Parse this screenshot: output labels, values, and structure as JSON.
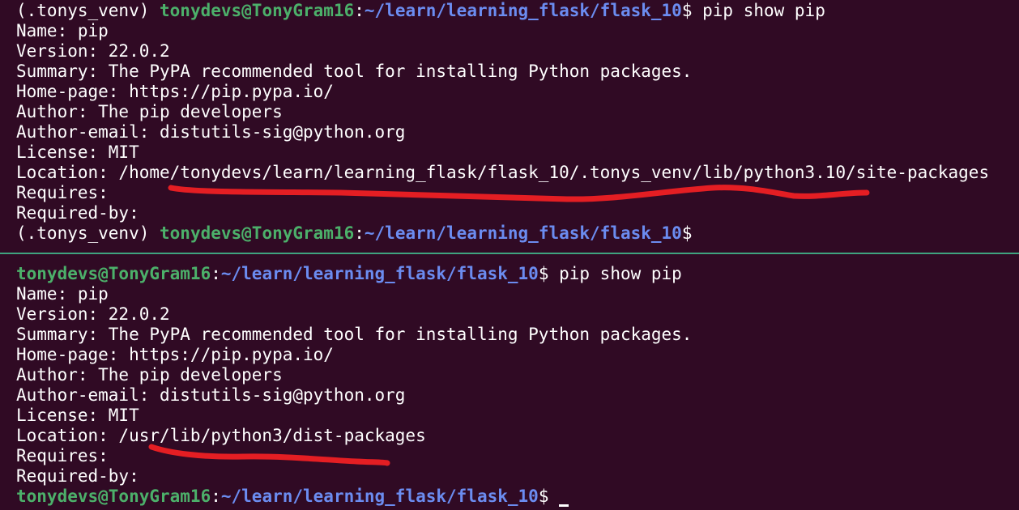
{
  "colors": {
    "background": "#300a24",
    "text": "#ffffff",
    "user_host": "#4cb06a",
    "path": "#6b8cf0",
    "divider": "#3fa37f",
    "annotation": "#e41e23"
  },
  "top_pane": {
    "prompt_venv": "(.tonys_venv) ",
    "prompt_user": "tonydevs@TonyGram16",
    "prompt_colon": ":",
    "prompt_path": "~/learn/learning_flask/flask_10",
    "prompt_dollar": "$",
    "command": " pip show pip",
    "output": [
      "Name: pip",
      "Version: 22.0.2",
      "Summary: The PyPA recommended tool for installing Python packages.",
      "Home-page: https://pip.pypa.io/",
      "Author: The pip developers",
      "Author-email: distutils-sig@python.org",
      "License: MIT",
      "Location: /home/tonydevs/learn/learning_flask/flask_10/.tonys_venv/lib/python3.10/site-packages",
      "Requires:",
      "Required-by:"
    ],
    "final_prompt_venv": "(.tonys_venv) ",
    "final_prompt_user": "tonydevs@TonyGram16",
    "final_prompt_colon": ":",
    "final_prompt_path": "~/learn/learning_flask/flask_10",
    "final_prompt_dollar": "$"
  },
  "bottom_pane": {
    "prompt_user": "tonydevs@TonyGram16",
    "prompt_colon": ":",
    "prompt_path": "~/learn/learning_flask/flask_10",
    "prompt_dollar": "$",
    "command": " pip show pip",
    "output": [
      "Name: pip",
      "Version: 22.0.2",
      "Summary: The PyPA recommended tool for installing Python packages.",
      "Home-page: https://pip.pypa.io/",
      "Author: The pip developers",
      "Author-email: distutils-sig@python.org",
      "License: MIT",
      "Location: /usr/lib/python3/dist-packages",
      "Requires:",
      "Required-by:"
    ],
    "final_prompt_user": "tonydevs@TonyGram16",
    "final_prompt_colon": ":",
    "final_prompt_path": "~/learn/learning_flask/flask_10",
    "final_prompt_dollar": "$ "
  }
}
